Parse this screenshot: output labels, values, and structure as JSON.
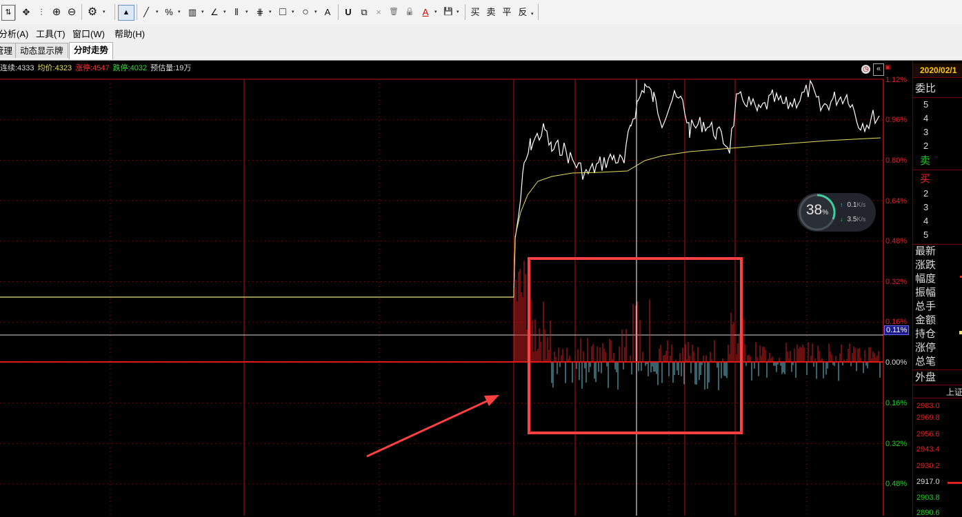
{
  "toolbar": {
    "pan_icon": "✥",
    "zoom_in_icon": "⊕",
    "zoom_out_icon": "⊖",
    "settings_icon": "⚙",
    "cursor_icon": "▲",
    "line_icon": "╱",
    "percent_icon": "%",
    "ruler_icon": "▥",
    "angle_icon": "∠",
    "fib_icon": "⫴",
    "grid_icon": "⋕",
    "rect_icon": "□",
    "circle_icon": "○",
    "text_icon": "A",
    "magnet_icon": "U",
    "copy_icon": "⧉",
    "delete_icon": "×",
    "trash_icon": "🗑",
    "lock_icon": "🔒",
    "color_icon": "A",
    "save_icon": "💾",
    "buy_label": "买",
    "sell_label": "卖",
    "flat_label": "平",
    "reverse_label": "反"
  },
  "menu": {
    "analysis": "分析(A)",
    "tools": "工具(T)",
    "window": "窗口(W)",
    "help": "帮助(H)"
  },
  "tabs": [
    {
      "label": "管理"
    },
    {
      "label": "动态显示牌"
    },
    {
      "label": "分时走势"
    }
  ],
  "infobar": {
    "continued": "连续:4333",
    "avg_price": "均价:4323",
    "limit_up": "涨停:4547",
    "limit_down": "跌停:4032",
    "estimated_volume": "预估量:19万"
  },
  "chart_data": {
    "type": "line",
    "y_ticks_right": [
      "1.12%",
      "0.96%",
      "0.80%",
      "0.64%",
      "0.48%",
      "0.32%",
      "0.16%",
      "0.00%",
      "0.16%",
      "0.32%",
      "0.48%"
    ],
    "current_marker": "0.11%",
    "series": [],
    "colors": {
      "price": "#ffffff",
      "average": "#e8e060",
      "up_bar": "#d21e1e",
      "down_bar": "#6cc8d8",
      "grid": "#b01010"
    }
  },
  "speed_widget": {
    "percent": "38",
    "percent_unit": "%",
    "up_speed": "0.1",
    "down_speed": "3.5",
    "unit": "K/s",
    "up_arrow": "↑",
    "down_arrow": "↓"
  },
  "right_panel": {
    "date": "2020/02/1",
    "weibi_label": "委比",
    "sell_levels": [
      "5",
      "4",
      "3",
      "2"
    ],
    "sell_label": "卖",
    "buy_label": "买",
    "buy_levels": [
      "2",
      "3",
      "4",
      "5"
    ],
    "stats_labels": [
      "最新",
      "涨跌",
      "幅度",
      "振幅",
      "总手",
      "金额",
      "持仓",
      "涨停",
      "总笔"
    ],
    "outer_label": "外盘",
    "index_label": "上证",
    "index_prices": [
      "2983.0",
      "2969.8",
      "2956.6",
      "2943.4",
      "2930.2",
      "2917.0",
      "2903.8",
      "2890.6"
    ]
  }
}
